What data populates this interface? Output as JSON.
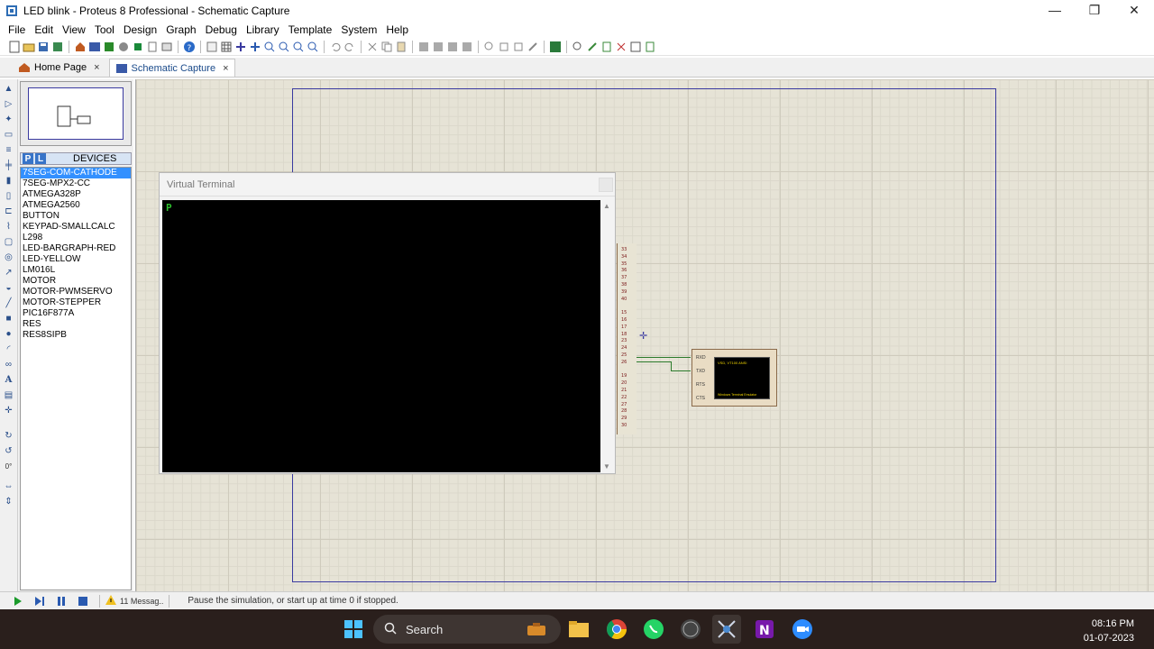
{
  "window": {
    "title": "LED blink - Proteus 8 Professional - Schematic Capture",
    "minimize": "—",
    "maximize": "❐",
    "close": "✕"
  },
  "menu": [
    "File",
    "Edit",
    "View",
    "Tool",
    "Design",
    "Graph",
    "Debug",
    "Library",
    "Template",
    "System",
    "Help"
  ],
  "tabs": [
    {
      "label": "Home Page",
      "close": "×",
      "active": false
    },
    {
      "label": "Schematic Capture",
      "close": "×",
      "active": true
    }
  ],
  "devices": {
    "header_p": "P",
    "header_l": "L",
    "header_label": "DEVICES",
    "items": [
      "7SEG-COM-CATHODE",
      "7SEG-MPX2-CC",
      "ATMEGA328P",
      "ATMEGA2560",
      "BUTTON",
      "KEYPAD-SMALLCALC",
      "L298",
      "LED-BARGRAPH-RED",
      "LED-YELLOW",
      "LM016L",
      "MOTOR",
      "MOTOR-PWMSERVO",
      "MOTOR-STEPPER",
      "PIC16F877A",
      "RES",
      "RES8SIPB"
    ],
    "selected_index": 0
  },
  "left_tools": {
    "rotation": "0°"
  },
  "virtual_terminal": {
    "title": "Virtual Terminal",
    "output": "P"
  },
  "vt_component": {
    "pins": [
      "RXD",
      "TXD",
      "RTS",
      "CTS"
    ],
    "screen_line1": "VSD, VT100 ANSI",
    "screen_line2": "Windows Terminal Emulator"
  },
  "pin_numbers": [
    "33",
    "34",
    "35",
    "36",
    "37",
    "38",
    "39",
    "40",
    "",
    "15",
    "16",
    "17",
    "18",
    "23",
    "24",
    "25",
    "26",
    "",
    "19",
    "20",
    "21",
    "22",
    "27",
    "28",
    "29",
    "30"
  ],
  "statusbar": {
    "messages": "11 Messag..",
    "status": "Pause the simulation, or start up at time 0 if stopped."
  },
  "taskbar": {
    "search_label": "Search",
    "time": "08:16 PM",
    "date": "01-07-2023"
  },
  "colors": {
    "accent": "#3390ff",
    "canvas": "#e6e3d6",
    "terminal_text": "#2fc02f",
    "taskbar": "#2a1f1c"
  }
}
